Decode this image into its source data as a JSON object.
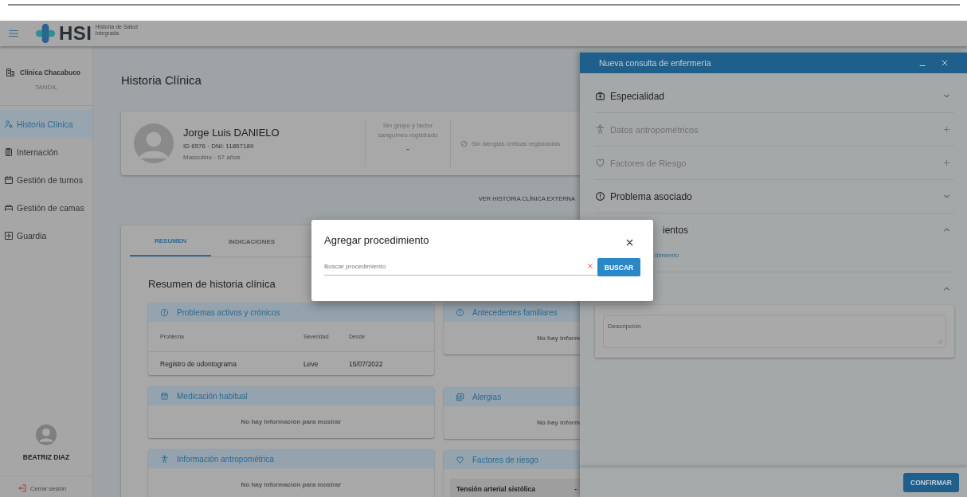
{
  "header": {
    "brand": "HSI",
    "brand_subtitle": "Historia de Salud Integrada"
  },
  "sidebar": {
    "institution": "Clínica Chacabuco",
    "city": "TANDIL",
    "items": [
      {
        "label": "Historia Clínica",
        "selected": true
      },
      {
        "label": "Internación",
        "selected": false
      },
      {
        "label": "Gestión de turnos",
        "selected": false
      },
      {
        "label": "Gestión de camas",
        "selected": false
      },
      {
        "label": "Guardia",
        "selected": false
      }
    ],
    "user": "BEATRIZ DIAZ",
    "logout": "Cerrar sesión"
  },
  "main": {
    "title": "Historia Clínica",
    "patient": {
      "name": "Jorge Luis DANIELO",
      "ids": "ID 6576 · DNI: 11857189",
      "details": "Masculino · 67 años",
      "blood_group": "Sin grupo y factor sanguíneo registrado",
      "blood_value": "-",
      "allergies": "Sin alergias críticas registradas"
    },
    "external_link": "VER HISTORIA CLÍNICA EXTERNA",
    "tabs": [
      {
        "label": "RESUMEN",
        "selected": true
      },
      {
        "label": "INDICACIONES",
        "selected": false
      }
    ],
    "summary_title": "Resumen de historia clínica",
    "left_cards": [
      {
        "kind": "table",
        "title": "Problemas activos y crónicos",
        "columns": [
          "Problema",
          "Severidad",
          "Desde"
        ],
        "rows": [
          [
            "Registro de odontograma",
            "Leve",
            "15/07/2022"
          ]
        ]
      },
      {
        "kind": "empty",
        "title": "Medicación habitual",
        "message": "No hay información para mostrar"
      },
      {
        "kind": "empty",
        "title": "Información antropométrica",
        "message": "No hay información para mostrar"
      }
    ],
    "right_cards": [
      {
        "kind": "empty",
        "title": "Antecedentes familiares",
        "message": "No hay inform"
      },
      {
        "kind": "empty",
        "title": "Alergias",
        "message": "No hay inform"
      },
      {
        "kind": "list",
        "title": "Factores de riesgo",
        "items": [
          {
            "label": "Tensión arterial sistólica",
            "value": "-"
          }
        ]
      }
    ]
  },
  "panel": {
    "title": "Nueva consulta de enfermería",
    "sections": [
      {
        "kind": "full",
        "title": "Especialidad",
        "expanded": false,
        "disabled": false
      },
      {
        "kind": "full",
        "title": "Datos antropométricos",
        "disabled": true
      },
      {
        "kind": "full",
        "title": "Factores de Riesgo",
        "disabled": true
      },
      {
        "kind": "full",
        "title": "Problema asociado",
        "expanded": false,
        "disabled": false
      },
      {
        "kind": "partial",
        "title": "ientos",
        "expanded": true,
        "disabled": false,
        "link": "dimiento"
      },
      {
        "kind": "partial",
        "expanded": true,
        "disabled": false,
        "textarea": {
          "placeholder": "Descripción"
        }
      }
    ],
    "confirm": "CONFIRMAR"
  },
  "modal": {
    "title": "Agregar procedimiento",
    "search": {
      "placeholder": "Buscar procedimiento"
    },
    "button": "BUSCAR"
  }
}
